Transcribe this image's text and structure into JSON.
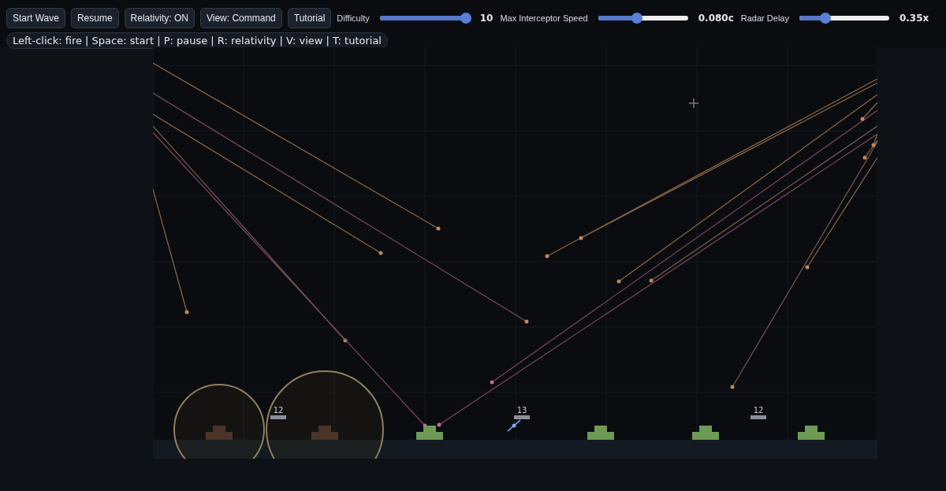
{
  "toolbar": {
    "buttons": [
      {
        "label": "Start Wave"
      },
      {
        "label": "Resume"
      },
      {
        "label": "Relativity: ON"
      },
      {
        "label": "View: Command"
      },
      {
        "label": "Tutorial"
      }
    ],
    "sliders": [
      {
        "label": "Difficulty",
        "level": 0.96,
        "reading": "10"
      },
      {
        "label": "Max Interceptor Speed",
        "level": 0.43,
        "reading": "0.080c"
      },
      {
        "label": "Radar Delay",
        "level": 0.29,
        "reading": "0.35x"
      }
    ]
  },
  "hint": "Left-click: fire | Space: start | P: pause | R: relativity | V: view | T: tutorial",
  "cities": [
    {
      "destroyed": true
    },
    {
      "destroyed": true
    },
    {
      "destroyed": false
    },
    {
      "destroyed": false
    },
    {
      "destroyed": false
    },
    {
      "destroyed": false
    }
  ],
  "launchers": [
    {
      "ammo": "12"
    },
    {
      "ammo": "13"
    },
    {
      "ammo": "12"
    }
  ]
}
